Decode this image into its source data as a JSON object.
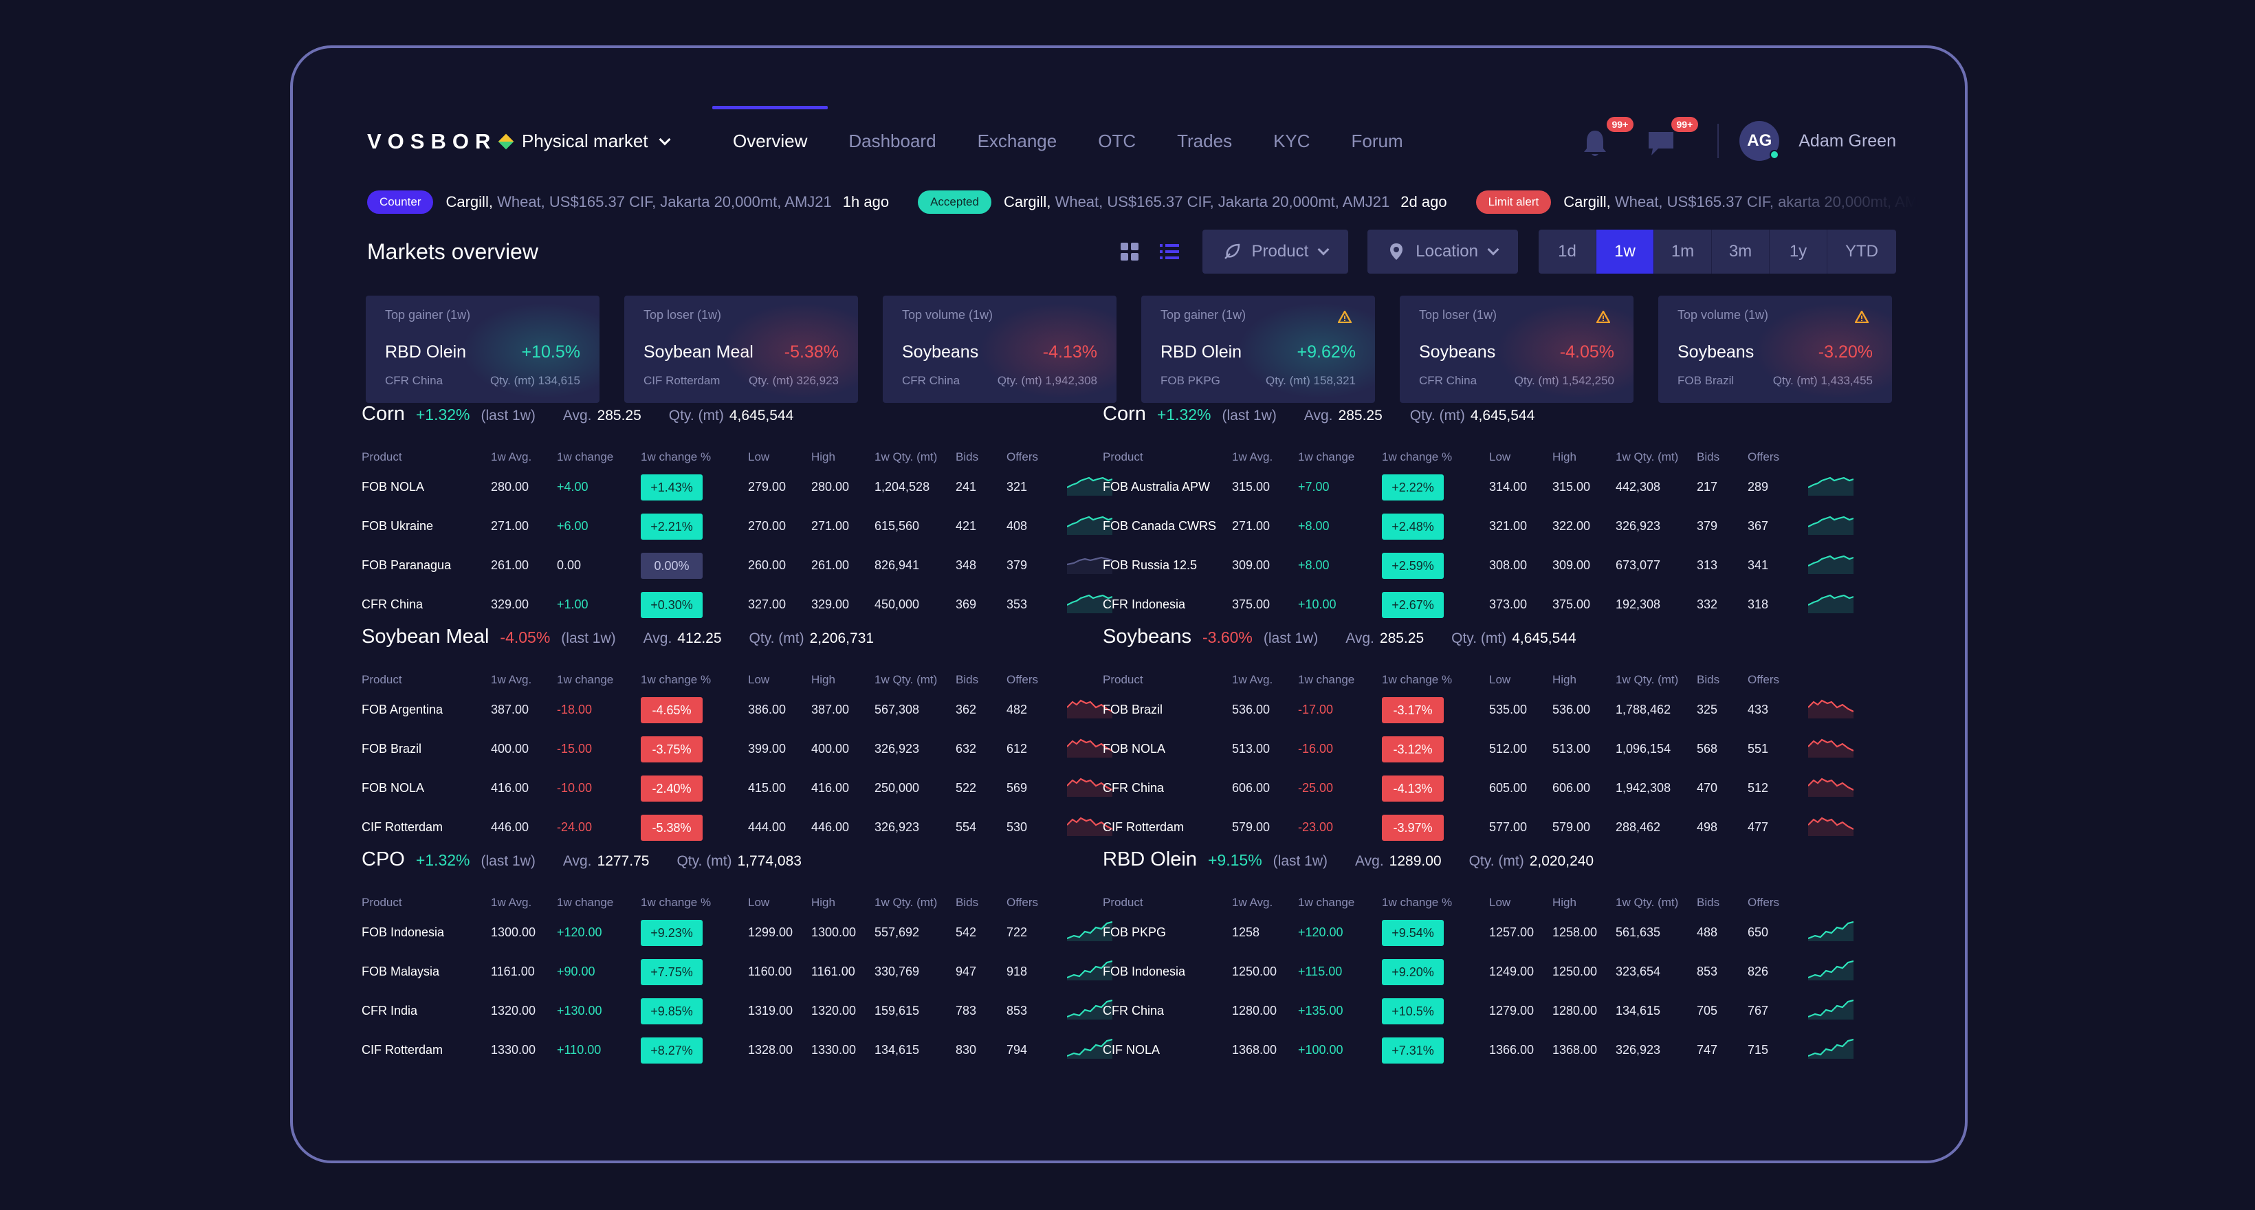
{
  "nav": {
    "logo": "VOSBOR",
    "market_select": "Physical market",
    "tabs": [
      "Overview",
      "Dashboard",
      "Exchange",
      "OTC",
      "Trades",
      "KYC",
      "Forum"
    ],
    "active_tab": "Overview",
    "notifications_badge": "99+",
    "messages_badge": "99+",
    "avatar_initials": "AG",
    "user_name": "Adam Green"
  },
  "ticker": [
    {
      "tag": "Counter",
      "company": "Cargill,",
      "details": "Wheat, US$165.37 CIF, Jakarta 20,000mt, AMJ21",
      "time": "1h ago"
    },
    {
      "tag": "Accepted",
      "company": "Cargill,",
      "details": "Wheat, US$165.37 CIF, Jakarta 20,000mt, AMJ21",
      "time": "2d ago"
    },
    {
      "tag": "Limit alert",
      "company": "Cargill,",
      "details": "Wheat, US$165.37 CIF, akarta 20,000mt, AMJ2",
      "time": ""
    }
  ],
  "overview": {
    "title": "Markets overview",
    "product_filter": "Product",
    "location_filter": "Location",
    "ranges": [
      "1d",
      "1w",
      "1m",
      "3m",
      "1y",
      "YTD"
    ],
    "active_range": "1w"
  },
  "cards": [
    {
      "label": "Top gainer (1w)",
      "product": "RBD Olein",
      "pct": "+10.5%",
      "dir": "up",
      "loc": "CFR China",
      "qty": "Qty. (mt) 134,615",
      "warn": false
    },
    {
      "label": "Top loser (1w)",
      "product": "Soybean Meal",
      "pct": "-5.38%",
      "dir": "down",
      "loc": "CIF Rotterdam",
      "qty": "Qty. (mt) 326,923",
      "warn": false
    },
    {
      "label": "Top volume (1w)",
      "product": "Soybeans",
      "pct": "-4.13%",
      "dir": "down",
      "loc": "CFR China",
      "qty": "Qty. (mt) 1,942,308",
      "warn": false
    },
    {
      "label": "Top gainer (1w)",
      "product": "RBD Olein",
      "pct": "+9.62%",
      "dir": "up",
      "loc": "FOB PKPG",
      "qty": "Qty. (mt) 158,321",
      "warn": true
    },
    {
      "label": "Top loser (1w)",
      "product": "Soybeans",
      "pct": "-4.05%",
      "dir": "down",
      "loc": "CFR China",
      "qty": "Qty. (mt) 1,542,250",
      "warn": true
    },
    {
      "label": "Top volume (1w)",
      "product": "Soybeans",
      "pct": "-3.20%",
      "dir": "down",
      "loc": "FOB Brazil",
      "qty": "Qty. (mt) 1,433,455",
      "warn": true
    }
  ],
  "columns": [
    "Product",
    "1w Avg.",
    "1w change",
    "1w change %",
    "Low",
    "High",
    "1w Qty. (mt)",
    "Bids",
    "Offers"
  ],
  "labels": {
    "last": "(last 1w)",
    "avg": "Avg.",
    "qty": "Qty. (mt)"
  },
  "markets": [
    {
      "name": "Corn",
      "change": "+1.32%",
      "dir": "up",
      "avg": "285.25",
      "qty": "4,645,544",
      "rows": [
        [
          "FOB NOLA",
          "280.00",
          "+4.00",
          "+1.43%",
          "279.00",
          "280.00",
          "1,204,528",
          "241",
          "321",
          "up"
        ],
        [
          "FOB Ukraine",
          "271.00",
          "+6.00",
          "+2.21%",
          "270.00",
          "271.00",
          "615,560",
          "421",
          "408",
          "up"
        ],
        [
          "FOB Paranagua",
          "261.00",
          "0.00",
          "0.00%",
          "260.00",
          "261.00",
          "826,941",
          "348",
          "379",
          "flat"
        ],
        [
          "CFR China",
          "329.00",
          "+1.00",
          "+0.30%",
          "327.00",
          "329.00",
          "450,000",
          "369",
          "353",
          "up"
        ]
      ]
    },
    {
      "name": "Corn",
      "change": "+1.32%",
      "dir": "up",
      "avg": "285.25",
      "qty": "4,645,544",
      "rows": [
        [
          "FOB Australia APW",
          "315.00",
          "+7.00",
          "+2.22%",
          "314.00",
          "315.00",
          "442,308",
          "217",
          "289",
          "up"
        ],
        [
          "FOB Canada CWRS",
          "271.00",
          "+8.00",
          "+2.48%",
          "321.00",
          "322.00",
          "326,923",
          "379",
          "367",
          "up"
        ],
        [
          "FOB Russia 12.5",
          "309.00",
          "+8.00",
          "+2.59%",
          "308.00",
          "309.00",
          "673,077",
          "313",
          "341",
          "up"
        ],
        [
          "CFR Indonesia",
          "375.00",
          "+10.00",
          "+2.67%",
          "373.00",
          "375.00",
          "192,308",
          "332",
          "318",
          "up"
        ]
      ]
    },
    {
      "name": "Soybean Meal",
      "change": "-4.05%",
      "dir": "down",
      "avg": "412.25",
      "qty": "2,206,731",
      "rows": [
        [
          "FOB Argentina",
          "387.00",
          "-18.00",
          "-4.65%",
          "386.00",
          "387.00",
          "567,308",
          "362",
          "482",
          "down"
        ],
        [
          "FOB Brazil",
          "400.00",
          "-15.00",
          "-3.75%",
          "399.00",
          "400.00",
          "326,923",
          "632",
          "612",
          "down"
        ],
        [
          "FOB NOLA",
          "416.00",
          "-10.00",
          "-2.40%",
          "415.00",
          "416.00",
          "250,000",
          "522",
          "569",
          "down"
        ],
        [
          "CIF Rotterdam",
          "446.00",
          "-24.00",
          "-5.38%",
          "444.00",
          "446.00",
          "326,923",
          "554",
          "530",
          "down"
        ]
      ]
    },
    {
      "name": "Soybeans",
      "change": "-3.60%",
      "dir": "down",
      "avg": "285.25",
      "qty": "4,645,544",
      "rows": [
        [
          "FOB Brazil",
          "536.00",
          "-17.00",
          "-3.17%",
          "535.00",
          "536.00",
          "1,788,462",
          "325",
          "433",
          "down"
        ],
        [
          "FOB NOLA",
          "513.00",
          "-16.00",
          "-3.12%",
          "512.00",
          "513.00",
          "1,096,154",
          "568",
          "551",
          "down"
        ],
        [
          "CFR China",
          "606.00",
          "-25.00",
          "-4.13%",
          "605.00",
          "606.00",
          "1,942,308",
          "470",
          "512",
          "down"
        ],
        [
          "CIF Rotterdam",
          "579.00",
          "-23.00",
          "-3.97%",
          "577.00",
          "579.00",
          "288,462",
          "498",
          "477",
          "down"
        ]
      ]
    },
    {
      "name": "CPO",
      "change": "+1.32%",
      "dir": "up",
      "avg": "1277.75",
      "qty": "1,774,083",
      "rows": [
        [
          "FOB Indonesia",
          "1300.00",
          "+120.00",
          "+9.23%",
          "1299.00",
          "1300.00",
          "557,692",
          "542",
          "722",
          "rise"
        ],
        [
          "FOB Malaysia",
          "1161.00",
          "+90.00",
          "+7.75%",
          "1160.00",
          "1161.00",
          "330,769",
          "947",
          "918",
          "rise"
        ],
        [
          "CFR India",
          "1320.00",
          "+130.00",
          "+9.85%",
          "1319.00",
          "1320.00",
          "159,615",
          "783",
          "853",
          "rise"
        ],
        [
          "CIF Rotterdam",
          "1330.00",
          "+110.00",
          "+8.27%",
          "1328.00",
          "1330.00",
          "134,615",
          "830",
          "794",
          "rise"
        ]
      ]
    },
    {
      "name": "RBD Olein",
      "change": "+9.15%",
      "dir": "up",
      "avg": "1289.00",
      "qty": "2,020,240",
      "rows": [
        [
          "FOB PKPG",
          "1258",
          "+120.00",
          "+9.54%",
          "1257.00",
          "1258.00",
          "561,635",
          "488",
          "650",
          "rise"
        ],
        [
          "FOB Indonesia",
          "1250.00",
          "+115.00",
          "+9.20%",
          "1249.00",
          "1250.00",
          "323,654",
          "853",
          "826",
          "rise"
        ],
        [
          "CFR China",
          "1280.00",
          "+135.00",
          "+10.5%",
          "1279.00",
          "1280.00",
          "134,615",
          "705",
          "767",
          "rise"
        ],
        [
          "CIF NOLA",
          "1368.00",
          "+100.00",
          "+7.31%",
          "1366.00",
          "1368.00",
          "326,923",
          "747",
          "715",
          "rise"
        ]
      ]
    }
  ],
  "colors": {
    "up": "#2de1b9",
    "down": "#ef5257",
    "accent": "#3730e8",
    "flat": "#5a5d8c"
  }
}
